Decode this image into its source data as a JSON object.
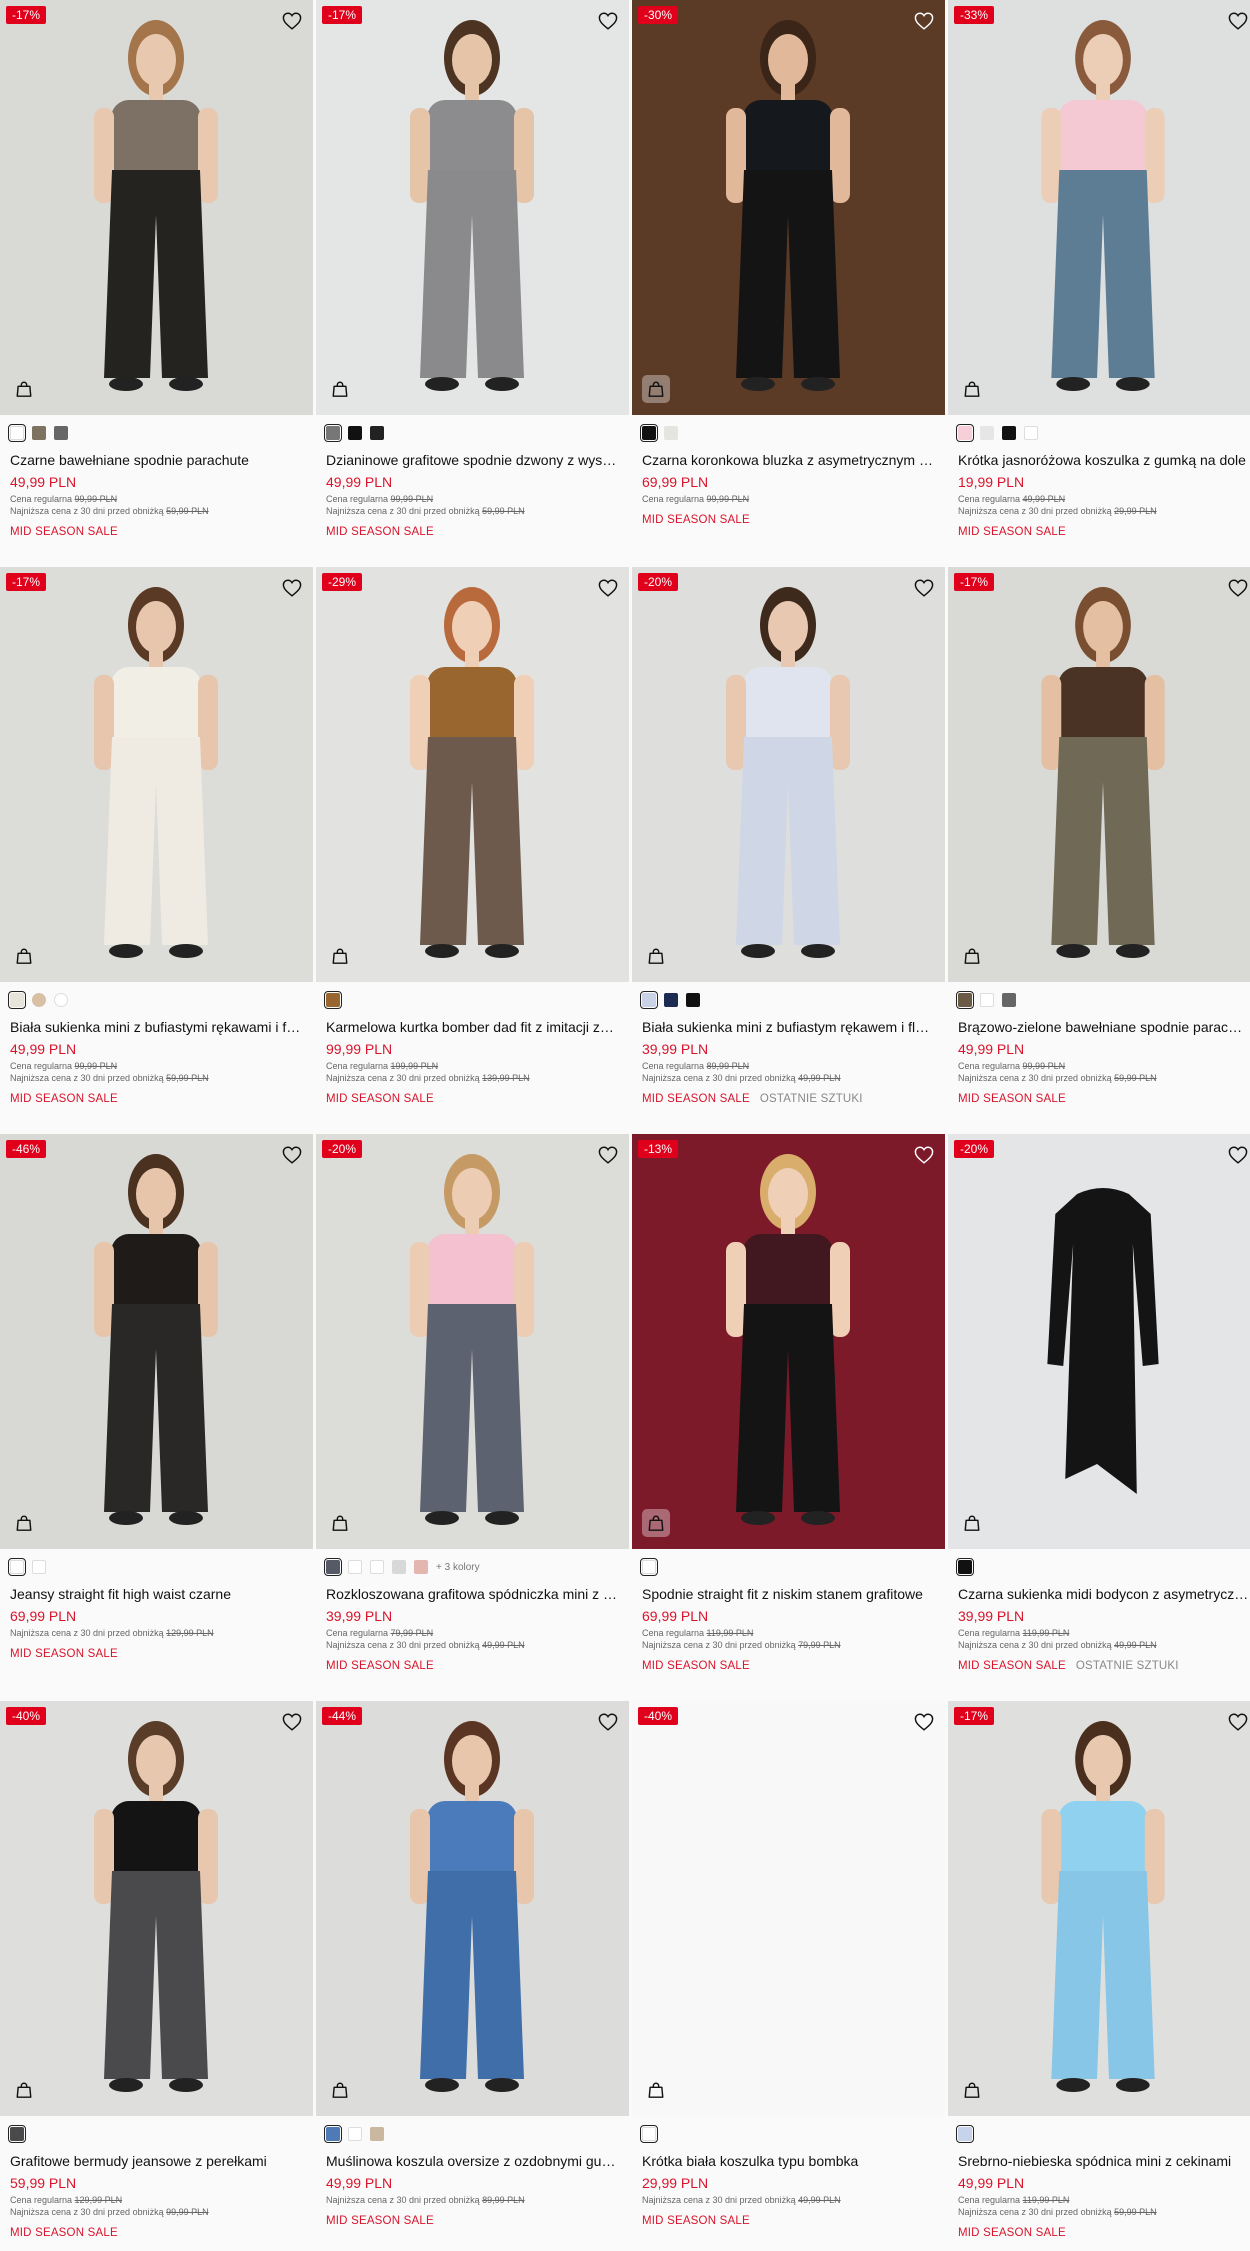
{
  "products": [
    {
      "badge": "-17%",
      "name": "Czarne bawełniane spodnie parachute",
      "price": "49,99 PLN",
      "regular_label": "Cena regularna",
      "regular_price": "99,99 PLN",
      "lowest_label": "Najniższa cena z 30 dni przed obniżką",
      "lowest_price": "59,99 PLN",
      "tag": "MID SEASON SALE",
      "tag2": "",
      "more": "",
      "bg": "#d9dad6",
      "skin": "#e8c9b0",
      "hair": "#a4744a",
      "top": "#7d7166",
      "bottom": "#25231f",
      "bag_dark": false,
      "swatches": [
        {
          "c": "#ffffff",
          "sel": true,
          "white": true
        },
        {
          "c": "#7e7260"
        },
        {
          "c": "#666666"
        }
      ]
    },
    {
      "badge": "-17%",
      "name": "Dzianinowe grafitowe spodnie dzwony z wysokim stanem",
      "price": "49,99 PLN",
      "regular_label": "Cena regularna",
      "regular_price": "99,99 PLN",
      "lowest_label": "Najniższa cena z 30 dni przed obniżką",
      "lowest_price": "59,99 PLN",
      "tag": "MID SEASON SALE",
      "tag2": "",
      "more": "",
      "bg": "#e4e6e6",
      "skin": "#e6c4a8",
      "hair": "#4c3322",
      "top": "#8c8c8e",
      "bottom": "#8a8a8c",
      "bag_dark": false,
      "swatches": [
        {
          "c": "#777777",
          "sel": true
        },
        {
          "c": "#111111"
        },
        {
          "c": "#222222"
        }
      ]
    },
    {
      "badge": "-30%",
      "name": "Czarna koronkowa bluzka z asymetrycznym dekoltem",
      "price": "69,99 PLN",
      "regular_label": "Cena regularna",
      "regular_price": "99,99 PLN",
      "lowest_label": "",
      "lowest_price": "",
      "tag": "MID SEASON SALE",
      "tag2": "",
      "more": "",
      "bg": "#5b3a26",
      "skin": "#e2b89a",
      "hair": "#3a2518",
      "top": "#15181c",
      "bottom": "#141414",
      "bag_dark": true,
      "swatches": [
        {
          "c": "#111111",
          "sel": true
        },
        {
          "c": "#e5e5e0"
        }
      ]
    },
    {
      "badge": "-33%",
      "name": "Krótka jasnoróżowa koszulka z gumką na dole",
      "price": "19,99 PLN",
      "regular_label": "Cena regularna",
      "regular_price": "49,99 PLN",
      "lowest_label": "Najniższa cena z 30 dni przed obniżką",
      "lowest_price": "29,99 PLN",
      "tag": "MID SEASON SALE",
      "tag2": "",
      "more": "",
      "bg": "#dedfdf",
      "skin": "#eccdb6",
      "hair": "#8a5a3c",
      "top": "#f5c9d3",
      "bottom": "#5d7d95",
      "bag_dark": false,
      "swatches": [
        {
          "c": "#f6cfd8",
          "sel": true
        },
        {
          "c": "#e6e6e6"
        },
        {
          "c": "#111111"
        },
        {
          "c": "#ffffff",
          "white": true
        }
      ]
    },
    {
      "badge": "-17%",
      "name": "Biała sukienka mini z bufiastymi rękawami i falbanami",
      "price": "49,99 PLN",
      "regular_label": "Cena regularna",
      "regular_price": "99,99 PLN",
      "lowest_label": "Najniższa cena z 30 dni przed obniżką",
      "lowest_price": "59,99 PLN",
      "tag": "MID SEASON SALE",
      "tag2": "",
      "more": "",
      "bg": "#dcdcd8",
      "skin": "#e7c6ad",
      "hair": "#5a3a24",
      "top": "#f1eee6",
      "bottom": "#efebe2",
      "bag_dark": false,
      "swatches": [
        {
          "c": "#e8e4da",
          "sel": true
        },
        {
          "c": "#d9c0a4",
          "round": true
        },
        {
          "c": "#ffffff",
          "white": true,
          "round": true
        }
      ]
    },
    {
      "badge": "-29%",
      "name": "Karmelowa kurtka bomber dad fit z imitacji zamszu",
      "price": "99,99 PLN",
      "regular_label": "Cena regularna",
      "regular_price": "199,99 PLN",
      "lowest_label": "Najniższa cena z 30 dni przed obniżką",
      "lowest_price": "139,99 PLN",
      "tag": "MID SEASON SALE",
      "tag2": "",
      "more": "",
      "bg": "#e2e3e1",
      "skin": "#f0cfb7",
      "hair": "#b86a3c",
      "top": "#9a6630",
      "bottom": "#6d5a4c",
      "bag_dark": false,
      "swatches": [
        {
          "c": "#9a6630",
          "sel": true
        }
      ]
    },
    {
      "badge": "-20%",
      "name": "Biała sukienka mini z bufiastym rękawem i florystycznym wzorem",
      "price": "39,99 PLN",
      "regular_label": "Cena regularna",
      "regular_price": "89,99 PLN",
      "lowest_label": "Najniższa cena z 30 dni przed obniżką",
      "lowest_price": "49,99 PLN",
      "tag": "MID SEASON SALE",
      "tag2": "OSTATNIE SZTUKI",
      "more": "",
      "bg": "#dededc",
      "skin": "#e8c8b0",
      "hair": "#3e2a1c",
      "top": "#dfe4ee",
      "bottom": "#cfd6e6",
      "bag_dark": false,
      "swatches": [
        {
          "c": "#c9d2e6",
          "sel": true
        },
        {
          "c": "#1d2a52"
        },
        {
          "c": "#111111"
        }
      ]
    },
    {
      "badge": "-17%",
      "name": "Brązowo-zielone bawełniane spodnie parachute",
      "price": "49,99 PLN",
      "regular_label": "Cena regularna",
      "regular_price": "99,99 PLN",
      "lowest_label": "Najniższa cena z 30 dni przed obniżką",
      "lowest_price": "59,99 PLN",
      "tag": "MID SEASON SALE",
      "tag2": "",
      "more": "",
      "bg": "#d9d9d6",
      "skin": "#e4bfa2",
      "hair": "#7a4e30",
      "top": "#4a3225",
      "bottom": "#6f6956",
      "bag_dark": false,
      "swatches": [
        {
          "c": "#6b5a45",
          "sel": true
        },
        {
          "c": "#ffffff",
          "white": true
        },
        {
          "c": "#666666"
        }
      ]
    },
    {
      "badge": "-46%",
      "name": "Jeansy straight fit high waist czarne",
      "price": "69,99 PLN",
      "regular_label": "",
      "regular_price": "",
      "lowest_label": "Najniższa cena z 30 dni przed obniżką",
      "lowest_price": "129,99 PLN",
      "tag": "MID SEASON SALE",
      "tag2": "",
      "more": "",
      "bg": "#d8d8d5",
      "skin": "#e7c5ab",
      "hair": "#4b3120",
      "top": "#1e1b19",
      "bottom": "#2a2826",
      "bag_dark": false,
      "swatches": [
        {
          "c": "#ffffff",
          "sel": true,
          "white": true
        },
        {
          "c": "#ffffff",
          "white": true
        }
      ]
    },
    {
      "badge": "-20%",
      "name": "Rozkloszowana grafitowa spódniczka mini z wysokim stanem",
      "price": "39,99 PLN",
      "regular_label": "Cena regularna",
      "regular_price": "79,99 PLN",
      "lowest_label": "Najniższa cena z 30 dni przed obniżką",
      "lowest_price": "49,99 PLN",
      "tag": "MID SEASON SALE",
      "tag2": "",
      "more": "+ 3 kolory",
      "bg": "#dcdcd9",
      "skin": "#ecccb3",
      "hair": "#c69a64",
      "top": "#f3c1cf",
      "bottom": "#5d6270",
      "bag_dark": false,
      "swatches": [
        {
          "c": "#555a66",
          "sel": true
        },
        {
          "c": "#ffffff",
          "white": true
        },
        {
          "c": "#ffffff",
          "white": true
        },
        {
          "c": "#d8d8d8"
        },
        {
          "c": "#e4b6b0"
        }
      ]
    },
    {
      "badge": "-13%",
      "name": "Spodnie straight fit z niskim stanem grafitowe",
      "price": "69,99 PLN",
      "regular_label": "Cena regularna",
      "regular_price": "119,99 PLN",
      "lowest_label": "Najniższa cena z 30 dni przed obniżką",
      "lowest_price": "79,99 PLN",
      "tag": "MID SEASON SALE",
      "tag2": "",
      "more": "",
      "bg": "#7d1a2a",
      "skin": "#efcfb6",
      "hair": "#d9ae6c",
      "top": "#421820",
      "bottom": "#141414",
      "bag_dark": true,
      "swatches": [
        {
          "c": "#ffffff",
          "sel": true,
          "white": true
        }
      ]
    },
    {
      "badge": "-20%",
      "name": "Czarna sukienka midi bodycon z asymetrycznym dołem",
      "price": "39,99 PLN",
      "regular_label": "Cena regularna",
      "regular_price": "119,99 PLN",
      "lowest_label": "Najniższa cena z 30 dni przed obniżką",
      "lowest_price": "49,99 PLN",
      "tag": "MID SEASON SALE",
      "tag2": "OSTATNIE SZTUKI",
      "more": "",
      "bg": "#e4e5e6",
      "skin": "",
      "hair": "",
      "top": "#141414",
      "bottom": "#141414",
      "bag_dark": false,
      "swatches": [
        {
          "c": "#111111",
          "sel": true
        }
      ]
    },
    {
      "badge": "-40%",
      "name": "Grafitowe bermudy jeansowe z perełkami",
      "price": "59,99 PLN",
      "regular_label": "Cena regularna",
      "regular_price": "129,99 PLN",
      "lowest_label": "Najniższa cena z 30 dni przed obniżką",
      "lowest_price": "99,99 PLN",
      "tag": "MID SEASON SALE",
      "tag2": "",
      "more": "",
      "bg": "#dededc",
      "skin": "#e7c7ae",
      "hair": "#5a3d28",
      "top": "#141414",
      "bottom": "#4a4a4c",
      "bag_dark": false,
      "swatches": [
        {
          "c": "#4a4a4c",
          "sel": true
        }
      ]
    },
    {
      "badge": "-44%",
      "name": "Muślinowa koszula oversize z ozdobnymi guzikami",
      "price": "49,99 PLN",
      "regular_label": "",
      "regular_price": "",
      "lowest_label": "Najniższa cena z 30 dni przed obniżką",
      "lowest_price": "89,99 PLN",
      "tag": "MID SEASON SALE",
      "tag2": "",
      "more": "",
      "bg": "#dcdcda",
      "skin": "#e8c6ac",
      "hair": "#5b3523",
      "top": "#4b7bbb",
      "bottom": "#3f6ea9",
      "bag_dark": false,
      "swatches": [
        {
          "c": "#4e7ab5",
          "sel": true
        },
        {
          "c": "#ffffff",
          "white": true
        },
        {
          "c": "#c9b7a0"
        }
      ]
    },
    {
      "badge": "-40%",
      "name": "Krótka biała koszulka typu bombka",
      "price": "29,99 PLN",
      "regular_label": "",
      "regular_price": "",
      "lowest_label": "Najniższa cena z 30 dni przed obniżką",
      "lowest_price": "49,99 PLN",
      "tag": "MID SEASON SALE",
      "tag2": "",
      "more": "",
      "bg": "#f8f8f8",
      "skin": "",
      "hair": "",
      "top": "",
      "bottom": "",
      "bag_dark": false,
      "swatches": [
        {
          "c": "#ffffff",
          "sel": true,
          "white": true
        }
      ]
    },
    {
      "badge": "-17%",
      "name": "Srebrno-niebieska spódnica mini z cekinami",
      "price": "49,99 PLN",
      "regular_label": "Cena regularna",
      "regular_price": "119,99 PLN",
      "lowest_label": "Najniższa cena z 30 dni przed obniżką",
      "lowest_price": "59,99 PLN",
      "tag": "MID SEASON SALE",
      "tag2": "",
      "more": "",
      "bg": "#dfdfdd",
      "skin": "#e8c8ae",
      "hair": "#4a2f1e",
      "top": "#8fd1ef",
      "bottom": "#88c6e8",
      "bag_dark": false,
      "swatches": [
        {
          "c": "#c7d3ea",
          "sel": true
        }
      ]
    }
  ]
}
